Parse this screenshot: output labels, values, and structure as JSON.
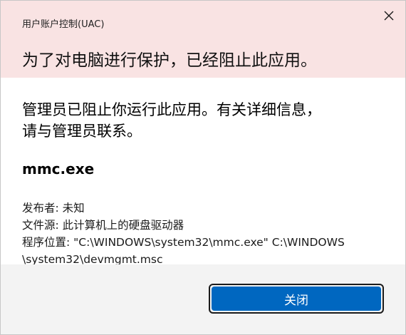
{
  "window": {
    "title": "用户账户控制(UAC)"
  },
  "header": {
    "headline": "为了对电脑进行保护，已经阻止此应用。"
  },
  "content": {
    "message": "管理员已阻止你运行此应用。有关详细信息，请与管理员联系。",
    "app_name": "mmc.exe",
    "publisher": "发布者: 未知",
    "file_source": "文件源: 此计算机上的硬盘驱动器",
    "program_location_line1": "程序位置: \"C:\\WINDOWS\\system32\\mmc.exe\" C:\\WINDOWS",
    "program_location_line2": "\\system32\\devmgmt.msc"
  },
  "footer": {
    "close_button_label": "关闭"
  },
  "colors": {
    "header_bg": "#f9e3e3",
    "footer_bg": "#f3f3f3",
    "accent": "#0067c0"
  },
  "icons": {
    "close": "close-icon"
  }
}
